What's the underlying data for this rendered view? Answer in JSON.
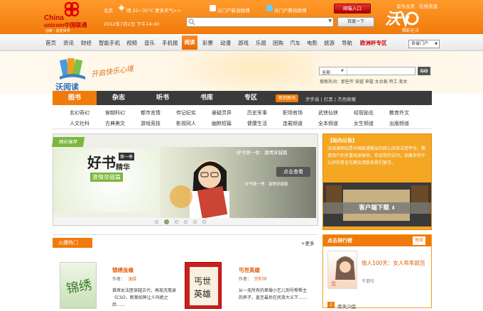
{
  "header": {
    "logo_en1": "China",
    "logo_en2": "unicom中国联通",
    "logo_slogan": "创新 · 改变世界",
    "city": "北京",
    "weather": "晴 22~35°C",
    "forecast_link": "更多天气>>",
    "date": "2012年7月2日 下午14:40",
    "weibo_sina": "沃门户新浪微博",
    "weibo_tencent": "沃门户腾讯微博",
    "login_label": "邮箱入口",
    "search_placeholder": "",
    "baidu_label": "百度一下",
    "set_home": "设为主页",
    "recharge": "在线充值",
    "wo_slogan": "精彩在沃"
  },
  "nav": {
    "items": [
      "首页",
      "资讯",
      "财经",
      "智能手机",
      "视频",
      "音乐",
      "手机报",
      "阅读",
      "彩票",
      "动漫",
      "游戏",
      "乐居",
      "团购",
      "汽车",
      "电影",
      "旅游",
      "导航",
      "欧洲杯专区"
    ],
    "active": "阅读",
    "portal_select": "各省门户"
  },
  "banner": {
    "brand": "沃阅读",
    "slogan": "开启快乐心境",
    "search_category": "全部",
    "search_btn": "GO",
    "hot_searches": "搜索热词：那些年  穿越  神墓  女总裁  特工  美女"
  },
  "tabs": [
    "图书",
    "杂志",
    "听书",
    "书库",
    "专区"
  ],
  "tab_active": "图书",
  "tab_extra": {
    "badge": "新到图书",
    "links": "步步高 | 打黑 | 杰色致暖"
  },
  "subcats": {
    "row1": [
      "玄幻奇幻",
      "穿越科幻",
      "都市言情",
      "传记纪实",
      "悬疑灵异",
      "历史军事",
      "职场官场",
      "武侠仙侠",
      "经管励志",
      "教育外文"
    ],
    "row2": [
      "人文社科",
      "古典美文",
      "游戏竞技",
      "影视同人",
      "幽默短篇",
      "健康生活",
      "连载频道",
      "全本频道",
      "女生频道",
      "出版频道"
    ]
  },
  "slider": {
    "tag": "精彩推荐",
    "title_big": "好书",
    "title_small": "第一季",
    "title_2": "精华",
    "title_3": "激情穿越篇",
    "caption": "好书第一季：激情穿越篇",
    "view_btn": "点击查看",
    "caption2": "好书第一季：激情穿越篇",
    "dots": 6,
    "active_dot": 2
  },
  "notice": {
    "title": "【站内公告】",
    "text": "沃阅读网站是中国联通推出的网上阅读试用平台，敬请用户的多重阅读体验，欢迎您的访问。如果你有什么好的意见与建议请联系我们留言。",
    "download": "客户端下载"
  },
  "hot": {
    "title": "火爆热门",
    "more": "+更多",
    "books": [
      {
        "title": "锦绣良缘",
        "author_label": "作者：",
        "author": "浅绿",
        "desc": "首席女法医穿越古代，再现洗冤录《CSI》，断案如神让人叫绝之后……"
      },
      {
        "title": "丐世英雄",
        "author_label": "作者：",
        "author": "宗利华",
        "desc": "从一无所有的卑微小乞儿到号帮帮主的养子，直至最后在民族大义下……"
      }
    ]
  },
  "rank": {
    "title": "点击排行榜",
    "period": "每周",
    "top": {
      "title": "情人100天：女人乖乖就范",
      "author": "千羽兮"
    },
    "second": "帝天少侣"
  }
}
